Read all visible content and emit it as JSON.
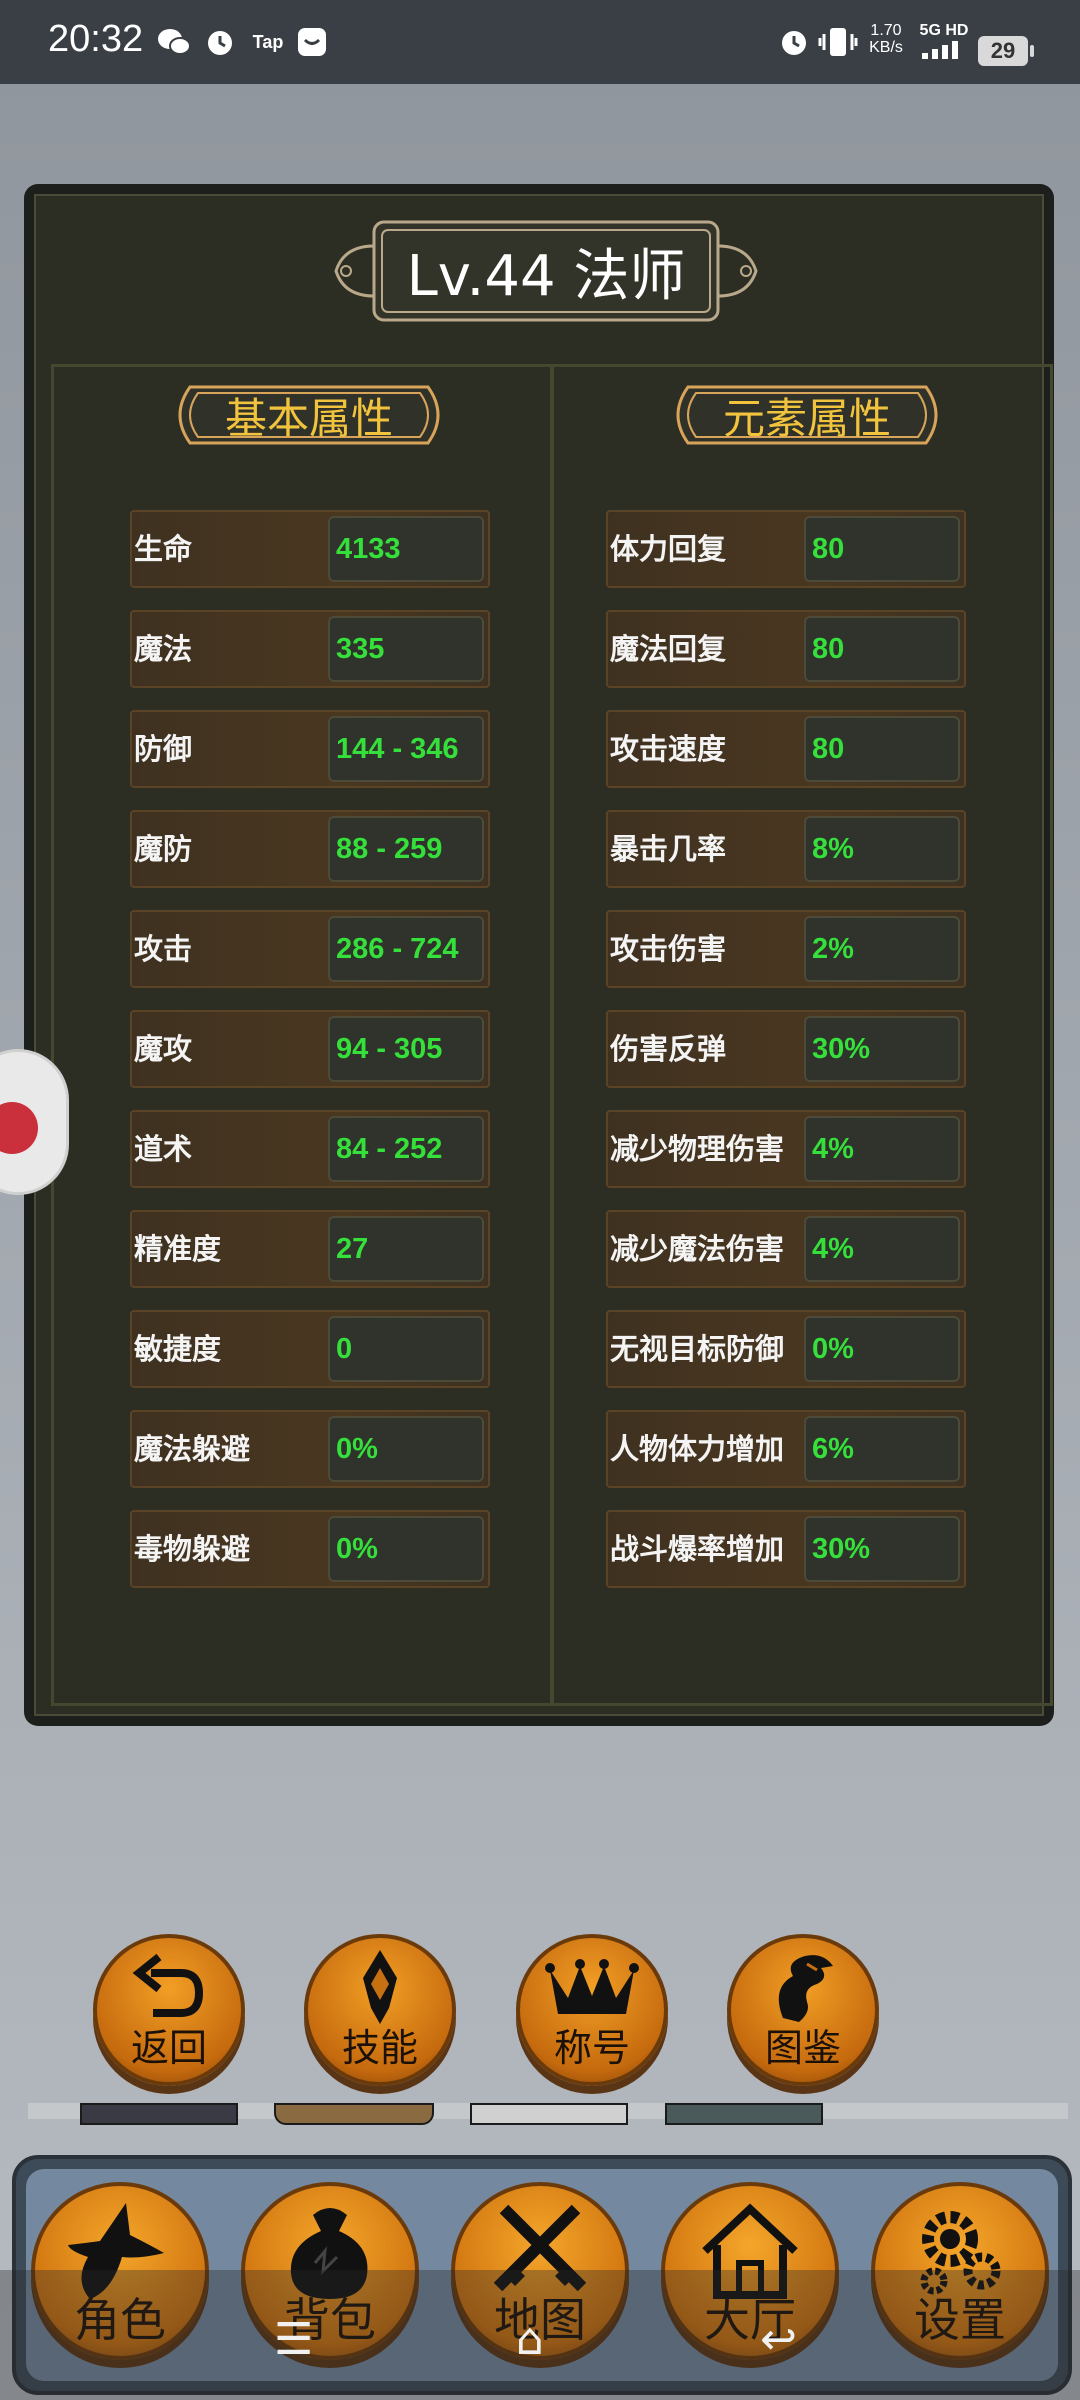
{
  "status_bar": {
    "time": "20:32",
    "left_icons": [
      "wechat-icon",
      "alarm-icon",
      "taptap-icon",
      "message-icon"
    ],
    "net_speed": "1.70",
    "net_unit": "KB/s",
    "network": "5G HD",
    "battery": "29"
  },
  "panel": {
    "title": "Lv.44 法师",
    "left_header": "基本属性",
    "right_header": "元素属性"
  },
  "basic_stats": [
    {
      "label": "生命",
      "value": "4133"
    },
    {
      "label": "魔法",
      "value": "335"
    },
    {
      "label": "防御",
      "value": "144 - 346"
    },
    {
      "label": "魔防",
      "value": "88 - 259"
    },
    {
      "label": "攻击",
      "value": "286 - 724"
    },
    {
      "label": "魔攻",
      "value": "94 - 305"
    },
    {
      "label": "道术",
      "value": "84 - 252"
    },
    {
      "label": "精准度",
      "value": "27"
    },
    {
      "label": "敏捷度",
      "value": "0"
    },
    {
      "label": "魔法躲避",
      "value": "0%"
    },
    {
      "label": "毒物躲避",
      "value": "0%"
    }
  ],
  "element_stats": [
    {
      "label": "体力回复",
      "value": "80"
    },
    {
      "label": "魔法回复",
      "value": "80"
    },
    {
      "label": "攻击速度",
      "value": "80"
    },
    {
      "label": "暴击几率",
      "value": "8%"
    },
    {
      "label": "攻击伤害",
      "value": "2%"
    },
    {
      "label": "伤害反弹",
      "value": "30%"
    },
    {
      "label": "减少物理伤害",
      "value": "4%"
    },
    {
      "label": "减少魔法伤害",
      "value": "4%"
    },
    {
      "label": "无视目标防御",
      "value": "0%"
    },
    {
      "label": "人物体力增加",
      "value": "6%"
    },
    {
      "label": "战斗爆率增加",
      "value": "30%"
    }
  ],
  "action_buttons": [
    {
      "label": "返回",
      "icon": "return-arrow-icon"
    },
    {
      "label": "技能",
      "icon": "skill-emblem-icon"
    },
    {
      "label": "称号",
      "icon": "crown-icon"
    },
    {
      "label": "图鉴",
      "icon": "dragon-icon"
    }
  ],
  "nav_buttons": [
    {
      "label": "角色",
      "icon": "wizard-icon"
    },
    {
      "label": "背包",
      "icon": "bag-icon"
    },
    {
      "label": "地图",
      "icon": "crossed-swords-icon"
    },
    {
      "label": "大厅",
      "icon": "house-icon"
    },
    {
      "label": "设置",
      "icon": "gears-icon"
    }
  ],
  "colors": {
    "stat_value": "#35e03b",
    "header_gold": "#f2c33d",
    "button_orange": "#e58a1c"
  }
}
